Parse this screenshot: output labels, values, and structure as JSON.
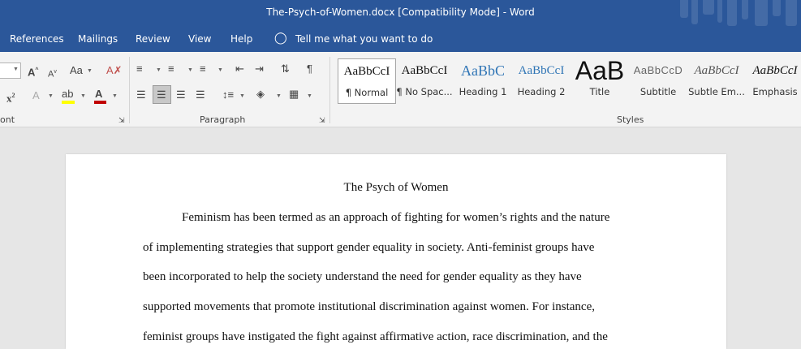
{
  "window": {
    "title": "The-Psych-of-Women.docx [Compatibility Mode]  -  Word"
  },
  "menu": {
    "references": "References",
    "mailings": "Mailings",
    "review": "Review",
    "view": "View",
    "help": "Help",
    "tell_me": "Tell me what you want to do"
  },
  "ribbon": {
    "font_group": "ont",
    "paragraph_group": "Paragraph",
    "styles_group": "Styles",
    "styles": [
      {
        "preview": "AaBbCcI",
        "label": "¶ Normal"
      },
      {
        "preview": "AaBbCcI",
        "label": "¶ No Spac..."
      },
      {
        "preview": "AaBbC",
        "label": "Heading 1"
      },
      {
        "preview": "AaBbCcI",
        "label": "Heading 2"
      },
      {
        "preview": "AaB",
        "label": "Title"
      },
      {
        "preview": "AaBbCcD",
        "label": "Subtitle"
      },
      {
        "preview": "AaBbCcI",
        "label": "Subtle Em..."
      },
      {
        "preview": "AaBbCcI",
        "label": "Emphasis"
      }
    ]
  },
  "document": {
    "title": "The Psych of Women",
    "lines": [
      "Feminism has been termed as an approach of fighting for women’s rights and the nature",
      "of implementing strategies that support gender equality in society. Anti-feminist groups have",
      "been incorporated to help the society understand the need for gender equality as they have",
      "supported movements that promote institutional discrimination against women. For instance,",
      "feminist groups have instigated the fight against affirmative action, race discrimination, and the"
    ]
  },
  "colors": {
    "accent": "#2b579a",
    "ribbon_bg": "#f3f3f3",
    "canvas": "#e6e6e6"
  }
}
